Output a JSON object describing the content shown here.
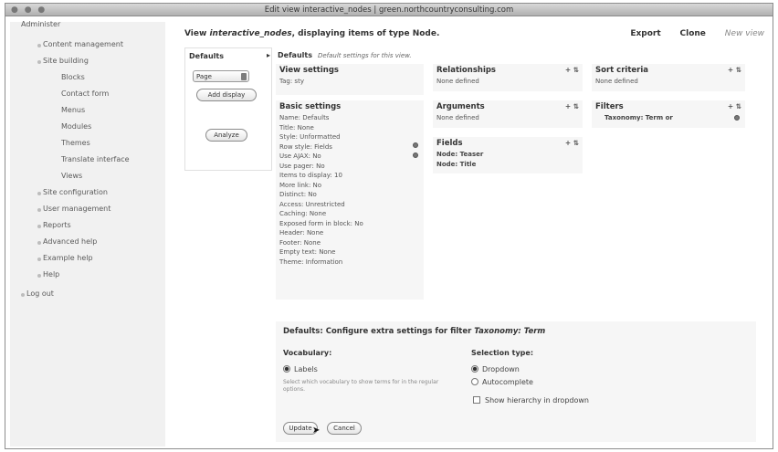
{
  "window": {
    "title": "Edit view interactive_nodes | green.northcountryconsulting.com",
    "controls": [
      "close",
      "minimize",
      "zoom"
    ]
  },
  "sidebar": {
    "header": "Administer",
    "items": [
      {
        "label": "Content management"
      },
      {
        "label": "Site building"
      },
      {
        "label": "Blocks"
      },
      {
        "label": "Contact form"
      },
      {
        "label": "Menus"
      },
      {
        "label": "Modules"
      },
      {
        "label": "Themes"
      },
      {
        "label": "Translate interface"
      },
      {
        "label": "Views"
      },
      {
        "label": "Site configuration"
      },
      {
        "label": "User management"
      },
      {
        "label": "Reports"
      },
      {
        "label": "Advanced help"
      },
      {
        "label": "Example help"
      },
      {
        "label": "Help"
      },
      {
        "label": "Log out"
      }
    ]
  },
  "header": {
    "view_prefix": "View ",
    "view_name": "interactive_nodes",
    "view_suffix": ", displaying items of type Node.",
    "export": "Export",
    "clone": "Clone",
    "new_view": "New view"
  },
  "displays": {
    "title": "Defaults",
    "arrow": "▸",
    "select_value": "Page",
    "add_display": "Add display",
    "analyze": "Analyze"
  },
  "defaults_header": {
    "label": "Defaults",
    "note": "Default settings for this view."
  },
  "view_settings": {
    "title": "View settings",
    "tag": "Tag: sty"
  },
  "basic_settings": {
    "title": "Basic settings",
    "lines": [
      "Name: Defaults",
      "Title: None",
      "Style: Unformatted",
      "Row style: Fields",
      "Use AJAX: No",
      "Use pager: No",
      "Items to display: 10",
      "More link: No",
      "Distinct: No",
      "Access: Unrestricted",
      "Caching: None",
      "Exposed form in block: No",
      "Header: None",
      "Footer: None",
      "Empty text: None",
      "Theme: Information"
    ]
  },
  "relationships": {
    "title": "Relationships",
    "tools": "+ ⇅",
    "body": "None defined"
  },
  "arguments": {
    "title": "Arguments",
    "tools": "+ ⇅",
    "body": "None defined"
  },
  "fields": {
    "title": "Fields",
    "tools": "+ ⇅",
    "items": [
      "Node: Teaser",
      "Node: Title"
    ]
  },
  "sort_criteria": {
    "title": "Sort criteria",
    "tools": "+ ⇅",
    "body": "None defined"
  },
  "filters": {
    "title": "Filters",
    "tools": "+ ⇅",
    "items": [
      "Taxonomy: Term or"
    ]
  },
  "extra_settings": {
    "title_prefix": "Defaults: Configure extra settings for filter ",
    "title_filter": "Taxonomy: Term",
    "vocabulary_label": "Vocabulary:",
    "vocabulary_option": "Labels",
    "vocabulary_help": "Select which vocabulary to show terms for in the regular options.",
    "selection_type_label": "Selection type:",
    "selection_options": [
      "Dropdown",
      "Autocomplete"
    ],
    "selection_selected": "Dropdown",
    "hierarchy_label": "Show hierarchy in dropdown",
    "update_button": "Update",
    "cancel_button": "Cancel"
  }
}
